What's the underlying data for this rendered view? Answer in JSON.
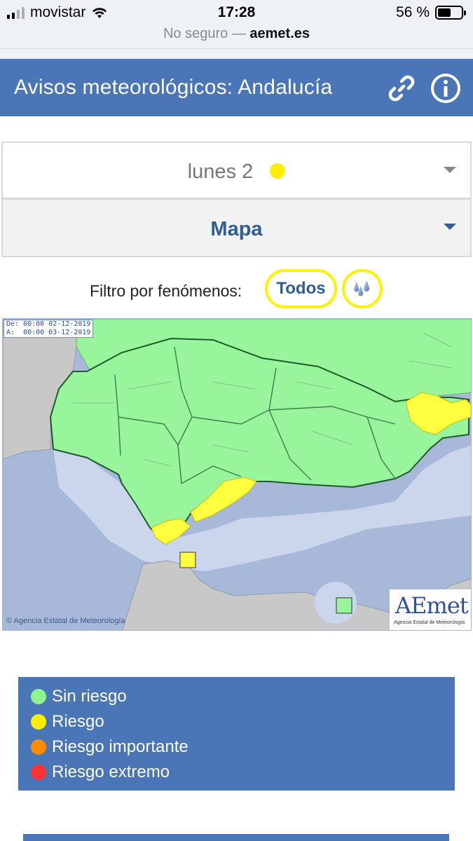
{
  "status_bar": {
    "carrier": "movistar",
    "time": "17:28",
    "battery_percent": "56 %",
    "battery_level": 0.56
  },
  "url_bar": {
    "security": "No seguro —",
    "domain": "aemet.es"
  },
  "header": {
    "title": "Avisos meteorológicos: Andalucía",
    "link_icon": "link-icon",
    "info_icon": "info-icon"
  },
  "day_selector": {
    "label": "lunes 2",
    "level_color": "#ffee00"
  },
  "map_section": {
    "label": "Mapa"
  },
  "filter": {
    "label": "Filtro por fenómenos:",
    "todos": "Todos",
    "rain_icon": "rain-icon"
  },
  "map": {
    "dates": "De: 00:00 02-12-2019\nA:  00:00 03-12-2019",
    "copyright": "© Agencia Estatal de Meteorología",
    "logo_text": "AEmet",
    "logo_sub": "Agencia Estatal de Meteorología"
  },
  "legend": [
    {
      "label": "Sin riesgo",
      "color": "#8ef58c"
    },
    {
      "label": "Riesgo",
      "color": "#ffee00"
    },
    {
      "label": "Riesgo importante",
      "color": "#ff8c00"
    },
    {
      "label": "Riesgo extremo",
      "color": "#ff3333"
    }
  ]
}
